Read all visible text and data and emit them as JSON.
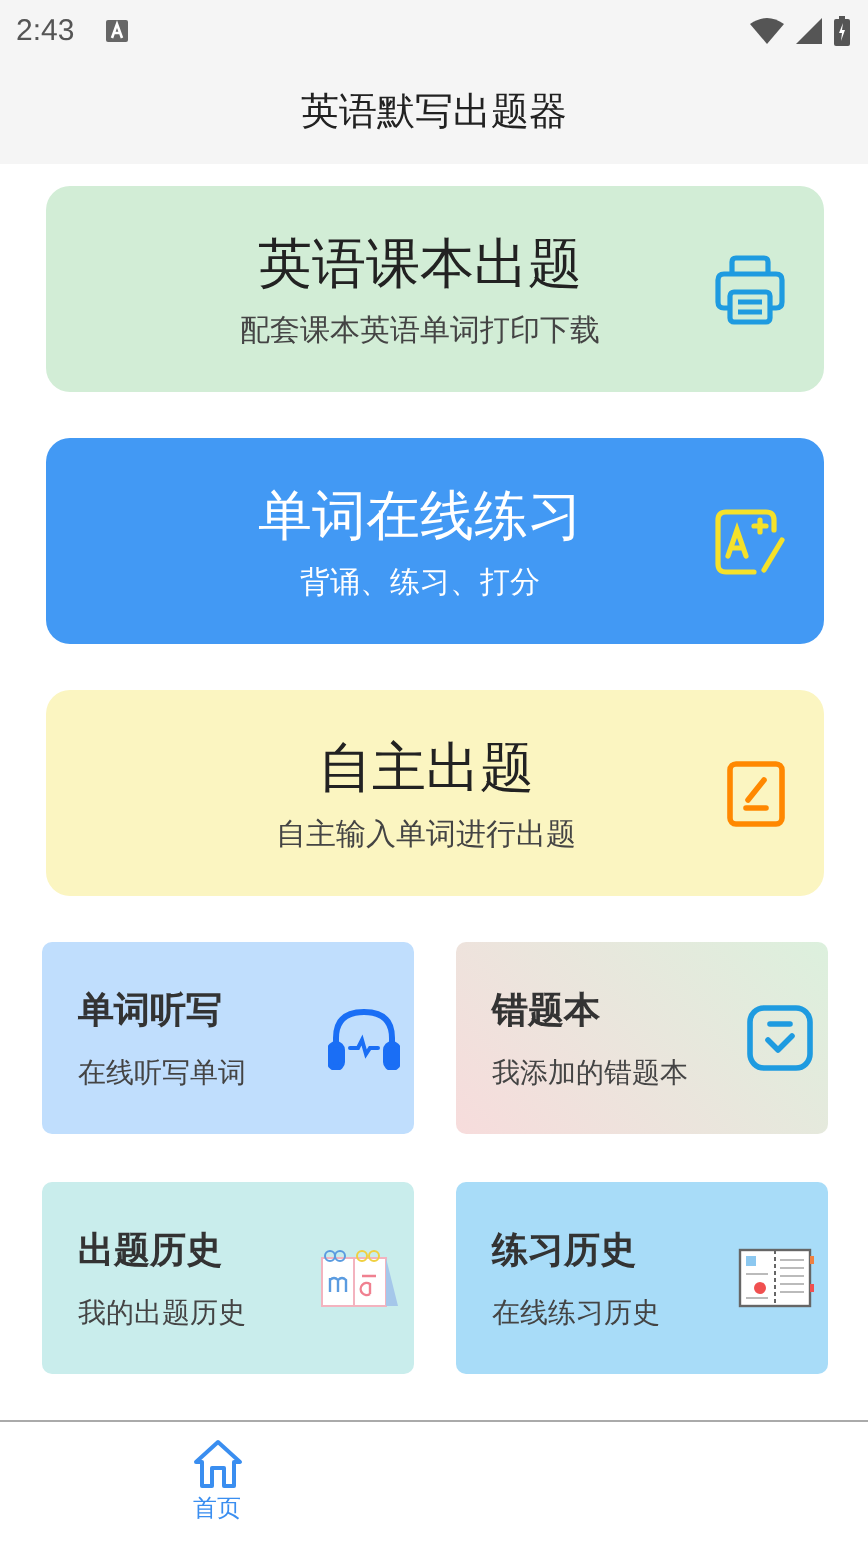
{
  "status_bar": {
    "time": "2:43"
  },
  "title": "英语默写出题器",
  "big_cards": [
    {
      "kind": "printer",
      "title": "英语课本出题",
      "subtitle": "配套课本英语单词打印下载"
    },
    {
      "kind": "grade",
      "title": "单词在线练习",
      "subtitle": "背诵、练习、打分"
    },
    {
      "kind": "edit",
      "title": "自主出题",
      "subtitle": "自主输入单词进行出题"
    }
  ],
  "small_cards": [
    {
      "kind": "headphones",
      "title": "单词听写",
      "subtitle": "在线听写单词"
    },
    {
      "kind": "check",
      "title": "错题本",
      "subtitle": "我添加的错题本"
    },
    {
      "kind": "calendar",
      "title": "出题历史",
      "subtitle": "我的出题历史"
    },
    {
      "kind": "notebook",
      "title": "练习历史",
      "subtitle": "在线练习历史"
    }
  ],
  "bottom_nav": [
    {
      "label": "首页",
      "selected": true
    }
  ]
}
